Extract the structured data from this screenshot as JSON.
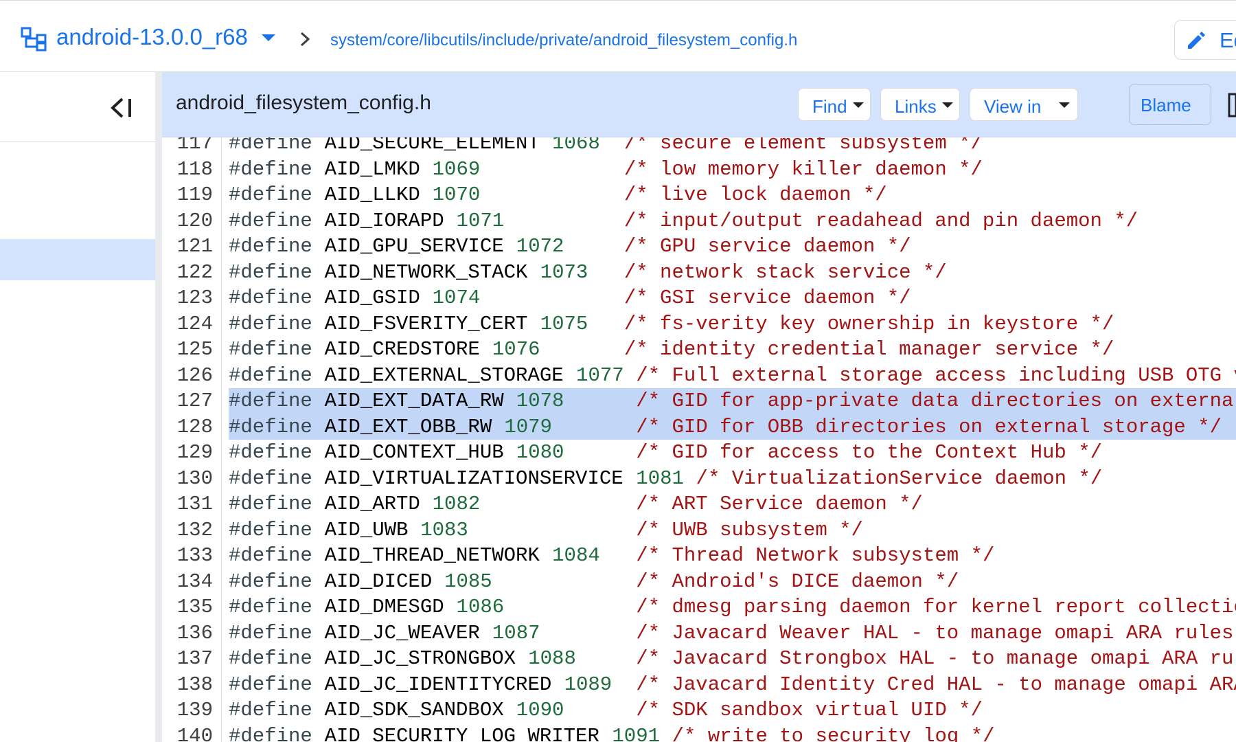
{
  "topbar": {
    "branch_name": "android-13.0.0_r68",
    "path": "system/core/libcutils/include/private/android_filesystem_config.h",
    "edit_label": "Ed"
  },
  "file_header": {
    "title": "android_filesystem_config.h",
    "buttons": {
      "find": "Find",
      "links": "Links",
      "view_in": "View in",
      "blame": "Blame"
    }
  },
  "code": {
    "keyword": "#define",
    "highlighted_lines": [
      127,
      128
    ],
    "lines": [
      {
        "ln": "117",
        "name": "AID_SECURE_ELEMENT",
        "num": "1068",
        "comment": "/* secure element subsystem */"
      },
      {
        "ln": "118",
        "name": "AID_LMKD",
        "num": "1069",
        "comment": "/* low memory killer daemon */"
      },
      {
        "ln": "119",
        "name": "AID_LLKD",
        "num": "1070",
        "comment": "/* live lock daemon */"
      },
      {
        "ln": "120",
        "name": "AID_IORAPD",
        "num": "1071",
        "comment": "/* input/output readahead and pin daemon */"
      },
      {
        "ln": "121",
        "name": "AID_GPU_SERVICE",
        "num": "1072",
        "comment": "/* GPU service daemon */"
      },
      {
        "ln": "122",
        "name": "AID_NETWORK_STACK",
        "num": "1073",
        "comment": "/* network stack service */"
      },
      {
        "ln": "123",
        "name": "AID_GSID",
        "num": "1074",
        "comment": "/* GSI service daemon */"
      },
      {
        "ln": "124",
        "name": "AID_FSVERITY_CERT",
        "num": "1075",
        "comment": "/* fs-verity key ownership in keystore */"
      },
      {
        "ln": "125",
        "name": "AID_CREDSTORE",
        "num": "1076",
        "comment": "/* identity credential manager service */"
      },
      {
        "ln": "126",
        "name": "AID_EXTERNAL_STORAGE",
        "num": "1077",
        "comment": "/* Full external storage access including USB OTG volumes */"
      },
      {
        "ln": "127",
        "name": "AID_EXT_DATA_RW",
        "num": "1078",
        "comment": "/* GID for app-private data directories on external storage */"
      },
      {
        "ln": "128",
        "name": "AID_EXT_OBB_RW",
        "num": "1079",
        "comment": "/* GID for OBB directories on external storage */"
      },
      {
        "ln": "129",
        "name": "AID_CONTEXT_HUB",
        "num": "1080",
        "comment": "/* GID for access to the Context Hub */"
      },
      {
        "ln": "130",
        "name": "AID_VIRTUALIZATIONSERVICE",
        "num": "1081",
        "comment": "/* VirtualizationService daemon */"
      },
      {
        "ln": "131",
        "name": "AID_ARTD",
        "num": "1082",
        "comment": "/* ART Service daemon */"
      },
      {
        "ln": "132",
        "name": "AID_UWB",
        "num": "1083",
        "comment": "/* UWB subsystem */"
      },
      {
        "ln": "133",
        "name": "AID_THREAD_NETWORK",
        "num": "1084",
        "comment": "/* Thread Network subsystem */"
      },
      {
        "ln": "134",
        "name": "AID_DICED",
        "num": "1085",
        "comment": "/* Android's DICE daemon */"
      },
      {
        "ln": "135",
        "name": "AID_DMESGD",
        "num": "1086",
        "comment": "/* dmesg parsing daemon for kernel report collection */"
      },
      {
        "ln": "136",
        "name": "AID_JC_WEAVER",
        "num": "1087",
        "comment": "/* Javacard Weaver HAL - to manage omapi ARA rules */"
      },
      {
        "ln": "137",
        "name": "AID_JC_STRONGBOX",
        "num": "1088",
        "comment": "/* Javacard Strongbox HAL - to manage omapi ARA rules */"
      },
      {
        "ln": "138",
        "name": "AID_JC_IDENTITYCRED",
        "num": "1089",
        "comment": "/* Javacard Identity Cred HAL - to manage omapi ARA rules */"
      },
      {
        "ln": "139",
        "name": "AID_SDK_SANDBOX",
        "num": "1090",
        "comment": "/* SDK sandbox virtual UID */"
      },
      {
        "ln": "140",
        "name": "AID_SECURITY_LOG_WRITER",
        "num": "1091",
        "comment": "/* write to security log */"
      }
    ]
  },
  "colors": {
    "link": "#1a73e8",
    "header_bg": "#d3e3fd",
    "highlight_bg": "#c2d7f7",
    "number": "#1e6b3c",
    "comment": "#a31515"
  }
}
